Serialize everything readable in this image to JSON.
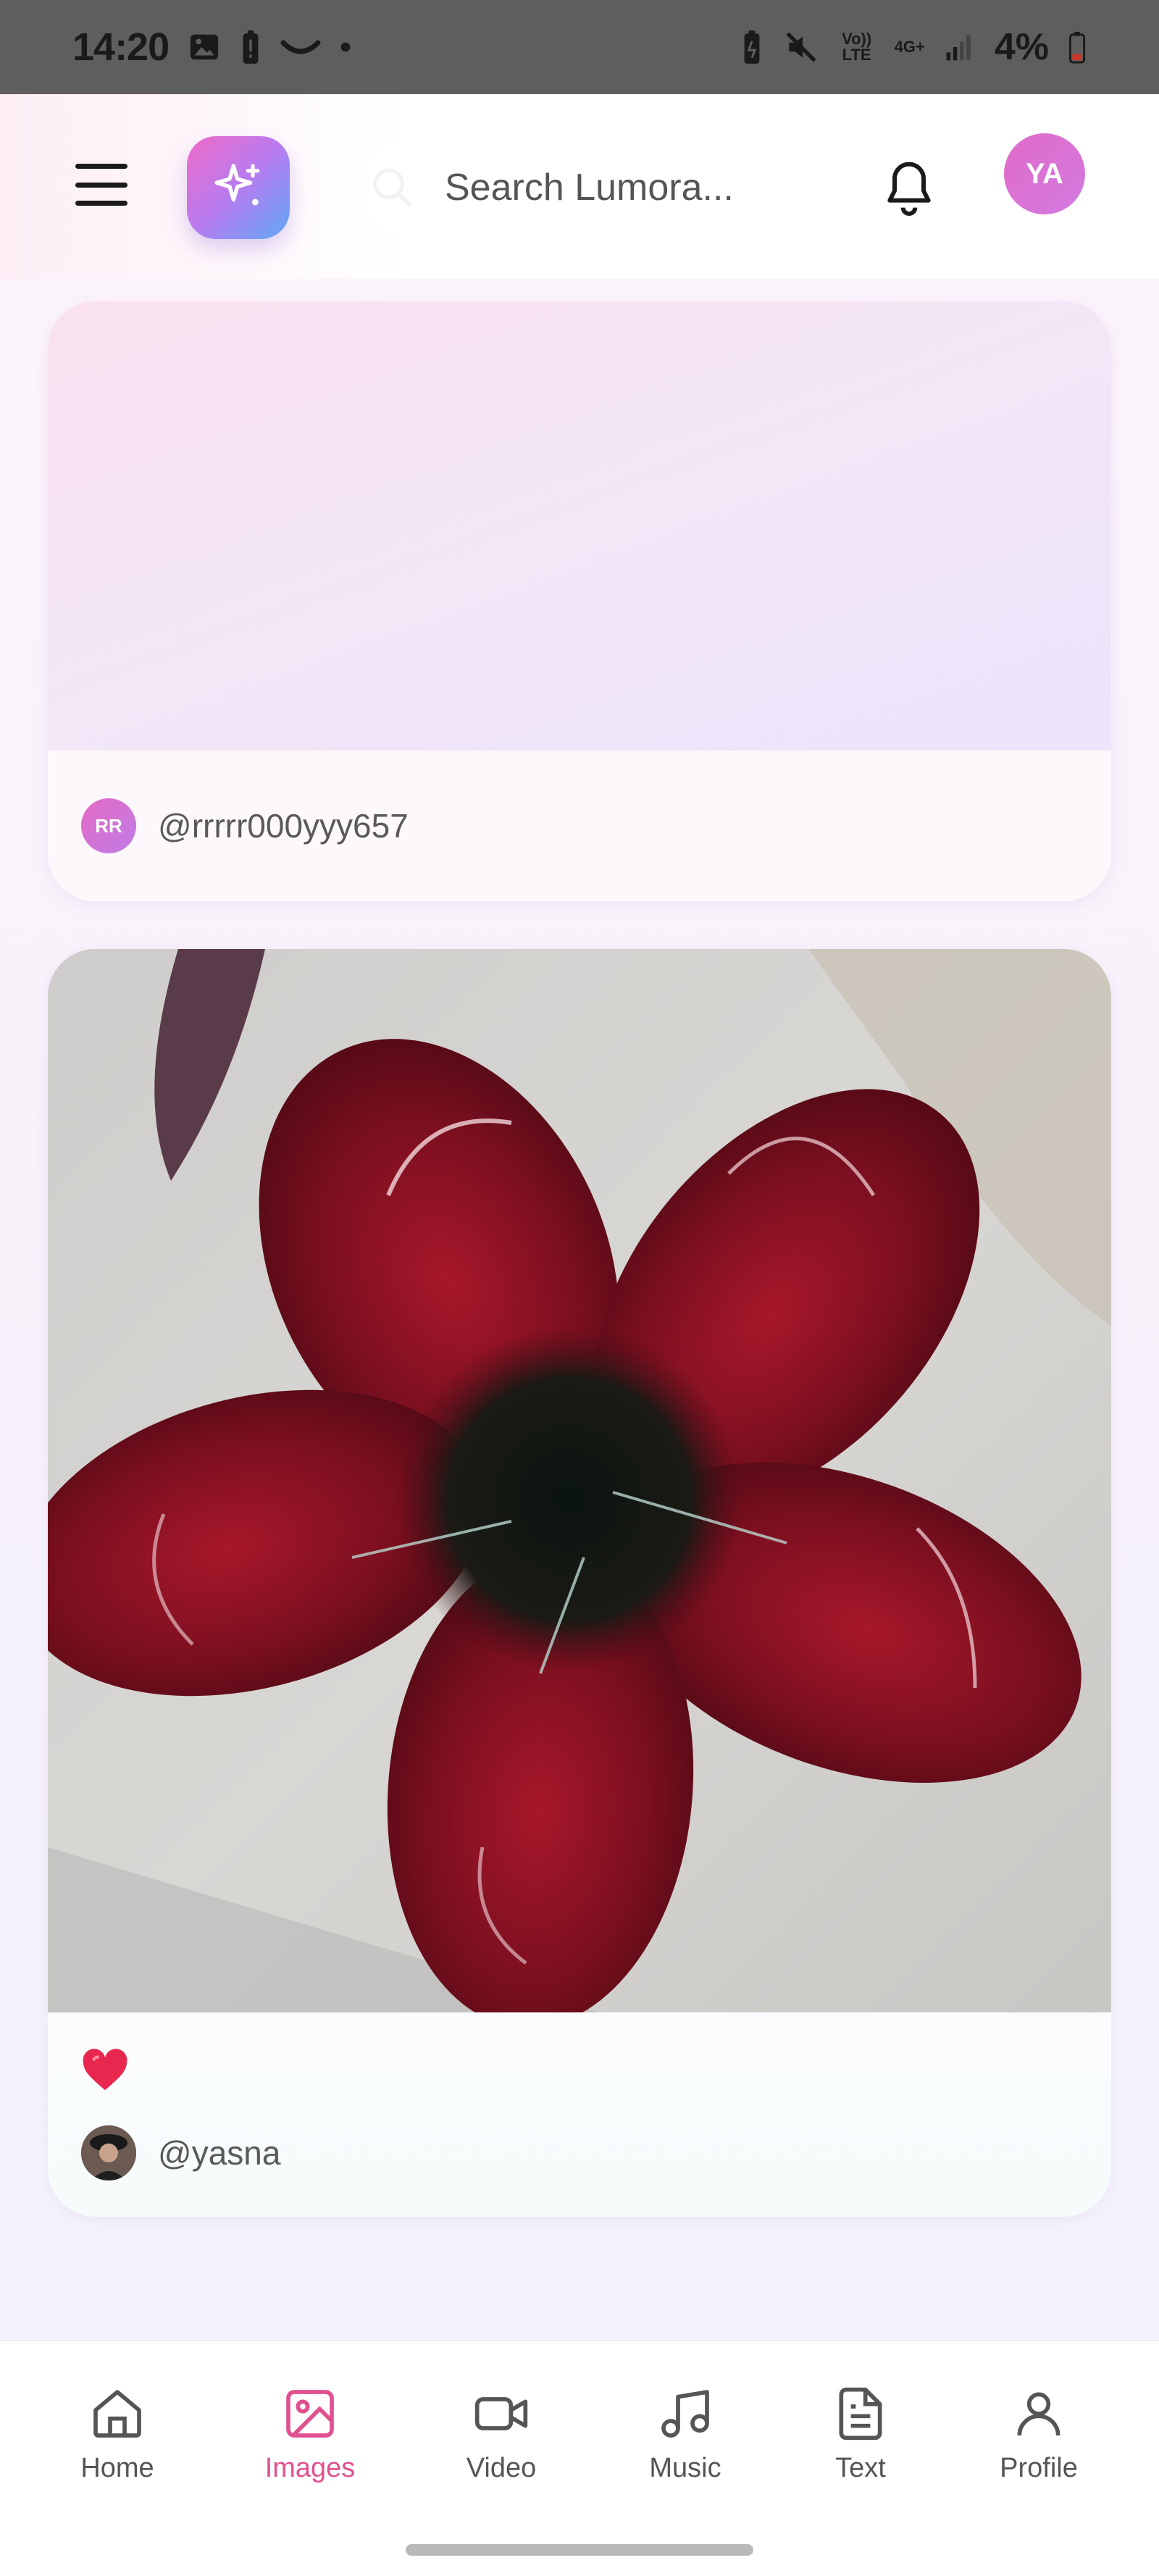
{
  "status_bar": {
    "time": "14:20",
    "network_volte": "Vo)) LTE",
    "network_type": "4G+",
    "battery_percent": "4%",
    "icons": [
      "image-icon",
      "battery-alert-icon",
      "smile-icon",
      "dot-icon",
      "battery-saver-icon",
      "mute-icon",
      "signal-icon",
      "battery-low-icon"
    ]
  },
  "header": {
    "menu_icon": "hamburger-menu-icon",
    "create_icon": "sparkle-icon",
    "search_placeholder": "Search Lumora...",
    "notifications_icon": "bell-icon",
    "user_initials": "YA",
    "brand_gradient": [
      "#f06bc8",
      "#b77bf0",
      "#5fa9f5"
    ]
  },
  "posts": [
    {
      "media": "gradient-placeholder",
      "author_initials": "RR",
      "author_handle": "@rrrrr000yyy657",
      "liked": false
    },
    {
      "media": "red-glass-flower-photo",
      "author_handle": "@yasna",
      "author_avatar": "profile-photo",
      "liked": true,
      "like_icon": "heart-icon"
    }
  ],
  "bottom_nav": {
    "active": "Images",
    "active_color": "#e0518f",
    "items": [
      {
        "label": "Home",
        "icon": "home-icon"
      },
      {
        "label": "Images",
        "icon": "image-icon"
      },
      {
        "label": "Video",
        "icon": "video-icon"
      },
      {
        "label": "Music",
        "icon": "music-icon"
      },
      {
        "label": "Text",
        "icon": "document-icon"
      },
      {
        "label": "Profile",
        "icon": "user-icon"
      }
    ]
  }
}
